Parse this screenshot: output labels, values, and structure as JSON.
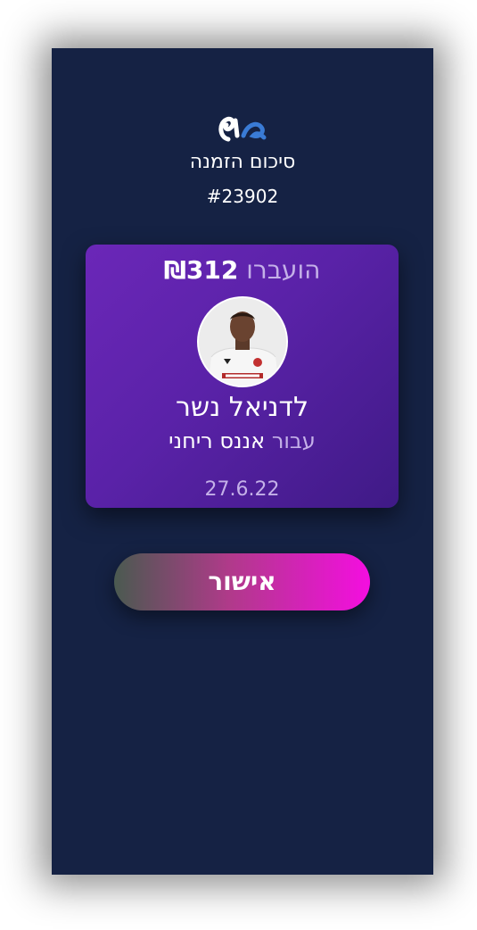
{
  "header": {
    "logo_icon": "app-logo-icon",
    "title": "סיכום הזמנה",
    "order_number": "#23902"
  },
  "card": {
    "transferred_label": "הועברו",
    "amount": "₪312",
    "avatar_icon": "recipient-photo",
    "recipient": "לדניאל נשר",
    "for_label": "עבור",
    "for_name": "אננס ריחני",
    "date": "27.6.22"
  },
  "actions": {
    "confirm_label": "אישור"
  },
  "colors": {
    "background": "#152244",
    "card_start": "#6b27b8",
    "card_end": "#3f1a86",
    "button_start": "#4a5a50",
    "button_end": "#f40ee0",
    "logo_blue": "#3a7bd5"
  }
}
